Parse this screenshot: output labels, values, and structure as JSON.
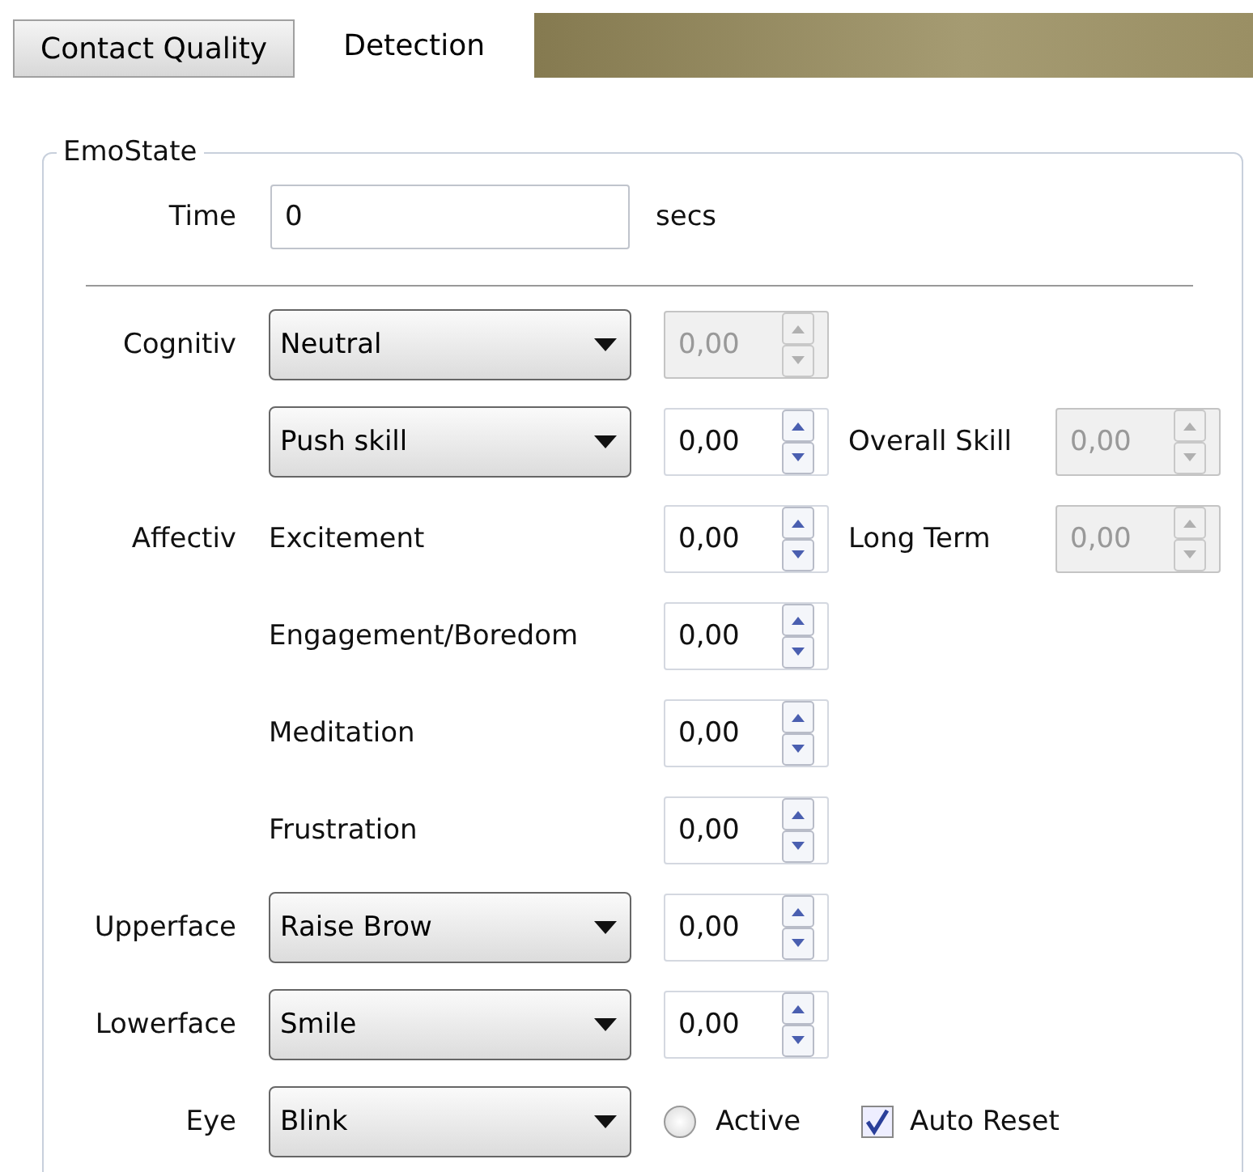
{
  "tabs": [
    {
      "label": "Contact Quality",
      "selected": false
    },
    {
      "label": "Detection",
      "selected": true
    }
  ],
  "group": {
    "title": "EmoState",
    "time": {
      "label": "Time",
      "value": "0",
      "unit": "secs"
    },
    "rows": [
      {
        "kind": "combo",
        "label": "Cognitiv",
        "value": "Neutral",
        "spin": {
          "value": "0,00",
          "disabled": true
        }
      },
      {
        "kind": "combo",
        "value": "Push skill",
        "spin": {
          "value": "0,00",
          "disabled": false
        },
        "extra": {
          "label": "Overall Skill",
          "spin": {
            "value": "0,00",
            "disabled": true
          }
        }
      },
      {
        "kind": "text",
        "label": "Affectiv",
        "value": "Excitement",
        "spin": {
          "value": "0,00",
          "disabled": false
        },
        "extra": {
          "label": "Long Term",
          "spin": {
            "value": "0,00",
            "disabled": true
          }
        }
      },
      {
        "kind": "text",
        "value": "Engagement/Boredom",
        "spin": {
          "value": "0,00",
          "disabled": false
        }
      },
      {
        "kind": "text",
        "value": "Meditation",
        "spin": {
          "value": "0,00",
          "disabled": false
        }
      },
      {
        "kind": "text",
        "value": "Frustration",
        "spin": {
          "value": "0,00",
          "disabled": false
        }
      },
      {
        "kind": "combo",
        "label": "Upperface",
        "value": "Raise Brow",
        "spin": {
          "value": "0,00",
          "disabled": false
        }
      },
      {
        "kind": "combo",
        "label": "Lowerface",
        "value": "Smile",
        "spin": {
          "value": "0,00",
          "disabled": false
        }
      },
      {
        "kind": "combo",
        "label": "Eye",
        "value": "Blink",
        "radio": {
          "label": "Active",
          "selected": false
        },
        "checkbox": {
          "label": "Auto Reset",
          "checked": true
        }
      }
    ]
  }
}
